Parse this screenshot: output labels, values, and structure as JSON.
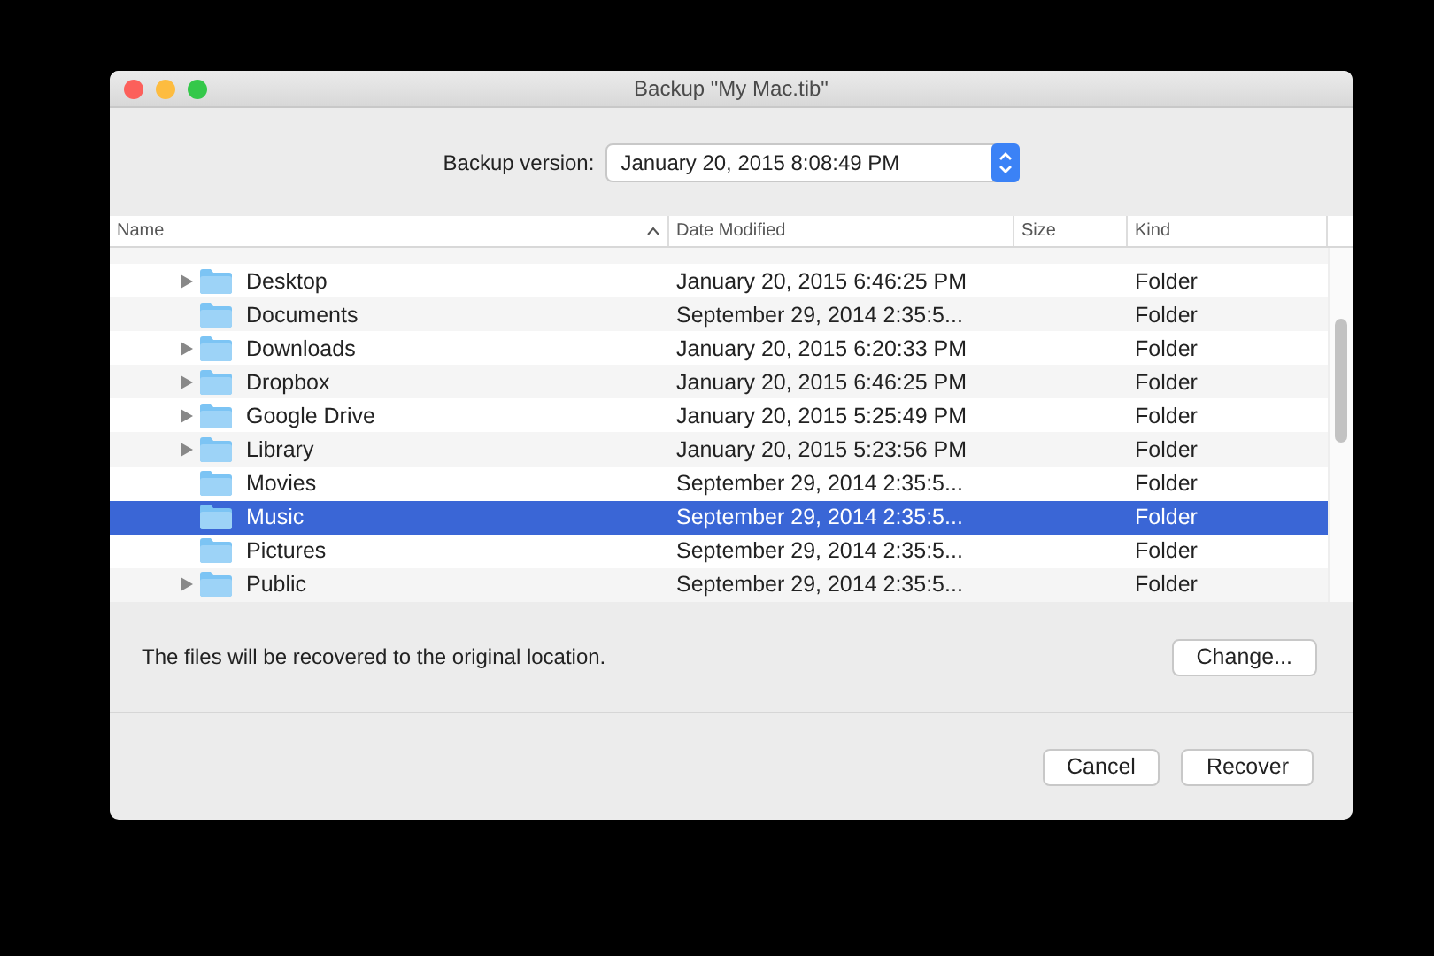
{
  "window": {
    "title": "Backup \"My Mac.tib\""
  },
  "backup_version": {
    "label": "Backup version:",
    "value": "January 20, 2015 8:08:49 PM"
  },
  "table": {
    "columns": [
      {
        "label": "Name",
        "sorted": true
      },
      {
        "label": "Date Modified",
        "sorted": false
      },
      {
        "label": "Size",
        "sorted": false
      },
      {
        "label": "Kind",
        "sorted": false
      }
    ],
    "rows": [
      {
        "name": "Desktop",
        "date": "January 20, 2015 6:46:25 PM",
        "kind": "Folder",
        "expandable": true,
        "selected": false
      },
      {
        "name": "Documents",
        "date": "September 29, 2014 2:35:5...",
        "kind": "Folder",
        "expandable": false,
        "selected": false
      },
      {
        "name": "Downloads",
        "date": "January 20, 2015 6:20:33 PM",
        "kind": "Folder",
        "expandable": true,
        "selected": false
      },
      {
        "name": "Dropbox",
        "date": "January 20, 2015 6:46:25 PM",
        "kind": "Folder",
        "expandable": true,
        "selected": false
      },
      {
        "name": "Google Drive",
        "date": "January 20, 2015 5:25:49 PM",
        "kind": "Folder",
        "expandable": true,
        "selected": false
      },
      {
        "name": "Library",
        "date": "January 20, 2015 5:23:56 PM",
        "kind": "Folder",
        "expandable": true,
        "selected": false
      },
      {
        "name": "Movies",
        "date": "September 29, 2014 2:35:5...",
        "kind": "Folder",
        "expandable": false,
        "selected": false
      },
      {
        "name": "Music",
        "date": "September 29, 2014 2:35:5...",
        "kind": "Folder",
        "expandable": false,
        "selected": true
      },
      {
        "name": "Pictures",
        "date": "September 29, 2014 2:35:5...",
        "kind": "Folder",
        "expandable": false,
        "selected": false
      },
      {
        "name": "Public",
        "date": "September 29, 2014 2:35:5...",
        "kind": "Folder",
        "expandable": true,
        "selected": false
      }
    ]
  },
  "location": {
    "message": "The files will be recovered to the original location.",
    "button": "Change..."
  },
  "buttons": [
    "Cancel",
    "Recover"
  ]
}
